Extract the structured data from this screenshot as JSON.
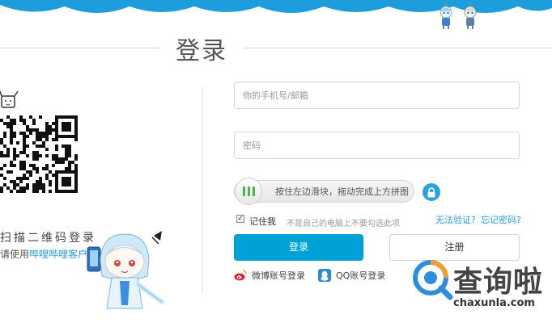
{
  "page": {
    "title": "登录"
  },
  "qr": {
    "caption": "扫描二维码登录",
    "hint_prefix": "请使用",
    "hint_link": "哔哩哔哩客户端"
  },
  "form": {
    "username_placeholder": "你的手机号/邮箱",
    "password_placeholder": "密码",
    "slider_text": "按住左边滑块，拖动完成上方拼图",
    "remember_label": "记住我",
    "remember_tip": "不是自己的电脑上不要勾选此项",
    "remember_checked": true,
    "verify_link": "无法验证?",
    "forgot_link": "忘记密码?",
    "login_button": "登录",
    "register_button": "注册"
  },
  "social": {
    "weibo_label": "微博账号登录",
    "qq_label": "QQ账号登录"
  },
  "watermark": {
    "text": "查询啦",
    "domain": "chaxunla.com"
  },
  "icons": {
    "lock": "lock-icon",
    "weibo": "weibo-icon",
    "qq": "qq-icon",
    "qr": "qr-code-icon"
  },
  "colors": {
    "accent": "#00a1d6",
    "link": "#2b9cdf",
    "top_band": "#1e9ddc",
    "slider_grip": "#4caf50",
    "weibo": "#e6162d",
    "qq": "#2b8bd6"
  }
}
